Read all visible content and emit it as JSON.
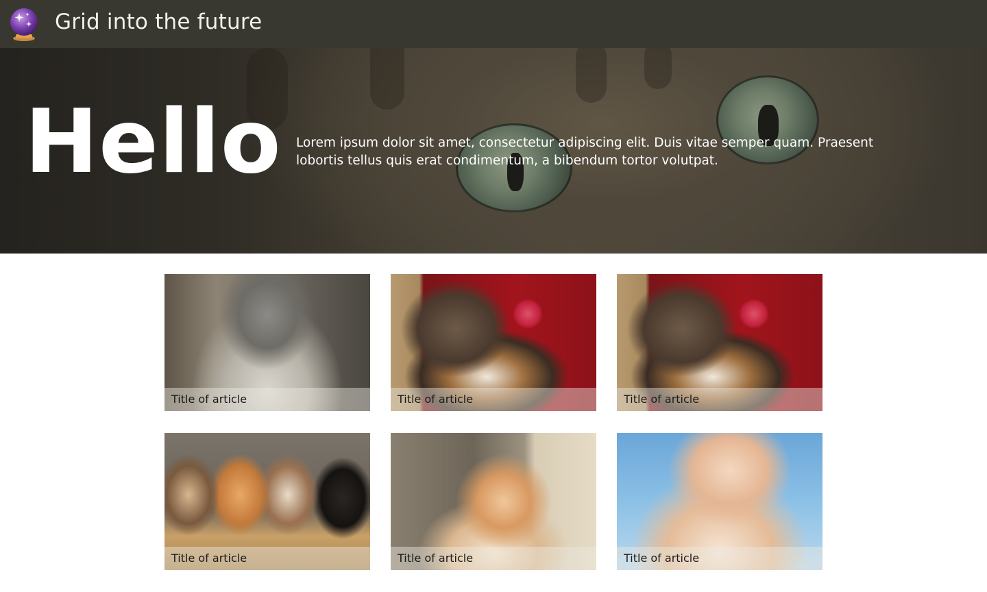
{
  "header": {
    "title": "Grid into the future",
    "logo_icon": "crystal-ball-icon"
  },
  "hero": {
    "title": "Hello",
    "text": "Lorem ipsum dolor sit amet, consectetur adipiscing elit. Duis vitae semper quam. Praesent lobortis tellus quis erat condimentum, a bibendum tortor volutpat."
  },
  "articles": [
    {
      "title": "Title of article",
      "image": "gray-tabby-kitten-photo"
    },
    {
      "title": "Title of article",
      "image": "calico-kitten-with-red-ball-photo"
    },
    {
      "title": "Title of article",
      "image": "calico-kitten-with-red-ball-photo"
    },
    {
      "title": "Title of article",
      "image": "four-kittens-in-basket-photo"
    },
    {
      "title": "Title of article",
      "image": "orange-white-kitten-photo"
    },
    {
      "title": "Title of article",
      "image": "white-kitten-blue-sky-photo"
    }
  ],
  "colors": {
    "header_bg": "#383730",
    "header_text": "#f2f2ec",
    "hero_text": "#ffffff"
  }
}
